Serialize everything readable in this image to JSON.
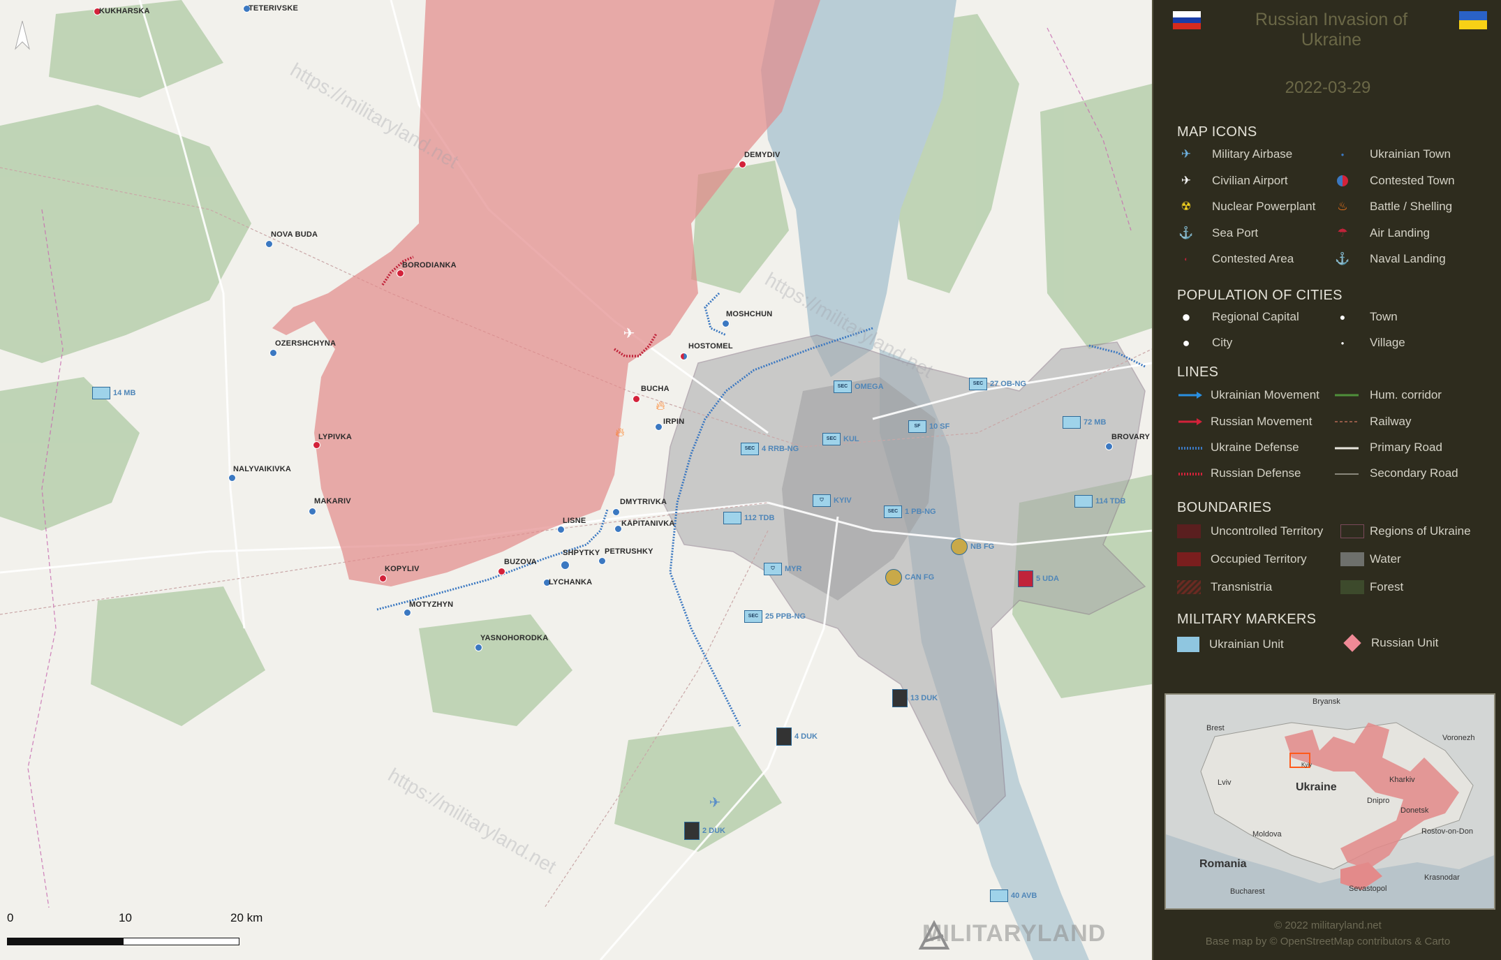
{
  "map": {
    "places": [
      {
        "id": "kukharska",
        "name": "KUKHARSKA",
        "side": "ru"
      },
      {
        "id": "teterivske",
        "name": "TETERIVSKE",
        "side": "ua"
      },
      {
        "id": "demydiv",
        "name": "DEMYDIV",
        "side": "ru"
      },
      {
        "id": "nova-buda",
        "name": "NOVA BUDA",
        "side": "ua"
      },
      {
        "id": "borodianka",
        "name": "BORODIANKA",
        "side": "ru"
      },
      {
        "id": "ozershchyna",
        "name": "OZERSHCHYNA",
        "side": "ua"
      },
      {
        "id": "moshchun",
        "name": "MOSHCHUN",
        "side": "ua"
      },
      {
        "id": "hostomel",
        "name": "HOSTOMEL",
        "side": "contested"
      },
      {
        "id": "bucha",
        "name": "BUCHA",
        "side": "ru"
      },
      {
        "id": "irpin",
        "name": "IRPIN",
        "side": "ua"
      },
      {
        "id": "lypivka",
        "name": "LYPIVKA",
        "side": "ru"
      },
      {
        "id": "nalyvaikivka",
        "name": "NALYVAIKIVKA",
        "side": "ua"
      },
      {
        "id": "makariv",
        "name": "MAKARIV",
        "side": "ua"
      },
      {
        "id": "dmytrivka",
        "name": "DMYTRIVKA",
        "side": "ua"
      },
      {
        "id": "kapitanivka",
        "name": "KAPITANIVKA",
        "side": "ua"
      },
      {
        "id": "lisne",
        "name": "LISNE",
        "side": "ua"
      },
      {
        "id": "shpytky",
        "name": "SHPYTKY",
        "side": "ua"
      },
      {
        "id": "petrushky",
        "name": "PETRUSHKY",
        "side": "ua"
      },
      {
        "id": "buzova",
        "name": "BUZOVA",
        "side": "ru"
      },
      {
        "id": "kopyliv",
        "name": "KOPYLIV",
        "side": "ru"
      },
      {
        "id": "lychanka",
        "name": "LYCHANKA",
        "side": "ua"
      },
      {
        "id": "motyzhyn",
        "name": "MOTYZHYN",
        "side": "ua"
      },
      {
        "id": "yasnohorodka",
        "name": "YASNOHORODKA",
        "side": "ua"
      },
      {
        "id": "brovary",
        "name": "BROVARY",
        "side": "ua"
      }
    ],
    "units": [
      {
        "id": "14mb",
        "label": "14 MB",
        "symbol": ""
      },
      {
        "id": "omega",
        "label": "OMEGA",
        "symbol": "SEC"
      },
      {
        "id": "27obng",
        "label": "27 OB-NG",
        "symbol": "SEC"
      },
      {
        "id": "72mb",
        "label": "72 MB",
        "symbol": ""
      },
      {
        "id": "10sf",
        "label": "10 SF",
        "symbol": "SF"
      },
      {
        "id": "4rrbng",
        "label": "4 RRB-NG",
        "symbol": "SEC"
      },
      {
        "id": "kul",
        "label": "KUL",
        "symbol": "SEC"
      },
      {
        "id": "kyiv",
        "label": "KYIV",
        "symbol": "⛉"
      },
      {
        "id": "1pbng",
        "label": "1 PB-NG",
        "symbol": "SEC"
      },
      {
        "id": "114tdb",
        "label": "114 TDB",
        "symbol": ""
      },
      {
        "id": "112tdb",
        "label": "112 TDB",
        "symbol": ""
      },
      {
        "id": "nbfg",
        "label": "NB FG",
        "symbol": ""
      },
      {
        "id": "myr",
        "label": "MYR",
        "symbol": "⛉"
      },
      {
        "id": "canfg",
        "label": "CAN FG",
        "symbol": ""
      },
      {
        "id": "5uda",
        "label": "5 UDA",
        "symbol": ""
      },
      {
        "id": "25ppbng",
        "label": "25 PPB-NG",
        "symbol": "SEC"
      },
      {
        "id": "13duk",
        "label": "13 DUK",
        "symbol": ""
      },
      {
        "id": "4duk",
        "label": "4 DUK",
        "symbol": ""
      },
      {
        "id": "2duk",
        "label": "2 DUK",
        "symbol": ""
      },
      {
        "id": "40avb",
        "label": "40 AVB",
        "symbol": ""
      }
    ],
    "watermarks": [
      "https://militaryland.net",
      "https://militaryland.net",
      "https://militaryland.net"
    ],
    "scale": {
      "labels": [
        "0",
        "10",
        "20 km"
      ]
    },
    "logo_text": "MILITARYLAND"
  },
  "panel": {
    "title": "Russian Invasion of Ukraine",
    "date": "2022-03-29",
    "sections": {
      "map_icons": "MAP ICONS",
      "population": "POPULATION OF CITIES",
      "lines": "LINES",
      "boundaries": "BOUNDARIES",
      "military": "MILITARY MARKERS"
    },
    "map_icons": [
      "Military Airbase",
      "Ukrainian Town",
      "Civilian Airport",
      "Contested Town",
      "Nuclear Powerplant",
      "Battle / Shelling",
      "Sea Port",
      "Air Landing",
      "Contested Area",
      "Naval Landing"
    ],
    "population": [
      "Regional Capital",
      "Town",
      "City",
      "Village"
    ],
    "lines": [
      "Ukrainian Movement",
      "Hum. corridor",
      "Russian Movement",
      "Railway",
      "Ukraine Defense",
      "Primary Road",
      "Russian Defense",
      "Secondary Road"
    ],
    "boundaries": [
      "Uncontrolled Territory",
      "Regions of Ukraine",
      "Occupied Territory",
      "Water",
      "Transnistria",
      "Forest"
    ],
    "military": [
      "Ukrainian Unit",
      "Russian Unit"
    ],
    "inset": {
      "labels": [
        "Bryansk",
        "Brest",
        "Voronezh",
        "Lviv",
        "Ukraine",
        "Kharkiv",
        "Dnipro",
        "Donetsk",
        "Moldova",
        "Rostov-on-Don",
        "Romania",
        "Sevastopol",
        "Krasnodar",
        "Bucharest",
        "Kyiv"
      ]
    },
    "credit": "© 2022 militaryland.net",
    "basemap": "Base map by © OpenStreetMap contributors & Carto"
  },
  "colors": {
    "occupied": "#e38a8a",
    "ukraine_blue": "#3b78c1",
    "russia_red": "#d3223a",
    "panel_bg": "#2e2c1e",
    "water": "#b9cdd6",
    "forest": "#a9c4a0"
  }
}
